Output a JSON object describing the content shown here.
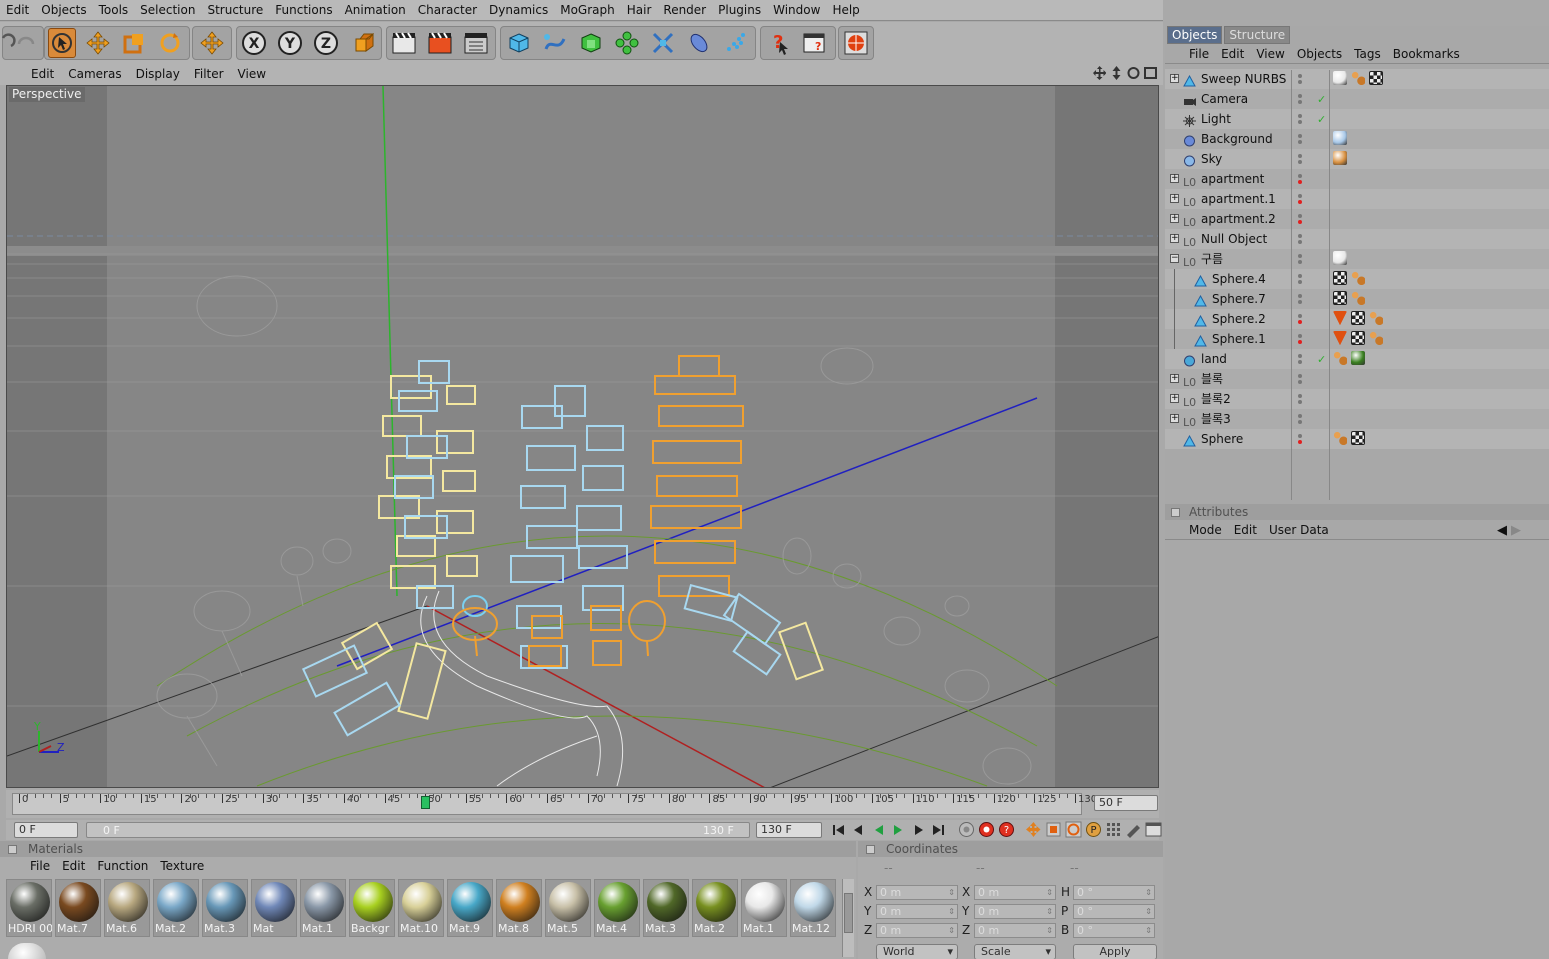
{
  "menubar": [
    "Edit",
    "Objects",
    "Tools",
    "Selection",
    "Structure",
    "Functions",
    "Animation",
    "Character",
    "Dynamics",
    "MoGraph",
    "Hair",
    "Render",
    "Plugins",
    "Window",
    "Help"
  ],
  "toolbar": {
    "axes": [
      "X",
      "Y",
      "Z"
    ],
    "icons": [
      "undo-icon",
      "redo-icon",
      "live-select-icon",
      "move-icon",
      "scale-icon",
      "rotate-icon",
      "object-axis-icon",
      "x-axis-lock-icon",
      "y-axis-lock-icon",
      "z-axis-lock-icon",
      "coordinate-system-icon",
      "render-view-icon",
      "render-picture-viewer-icon",
      "render-settings-icon",
      "cube-primitive-icon",
      "spline-icon",
      "nurbs-icon",
      "array-icon",
      "deformer-icon",
      "scene-icon",
      "particles-icon",
      "help-icon",
      "interactive-render-icon",
      "render-world-icon"
    ]
  },
  "viewport": {
    "menu": [
      "Edit",
      "Cameras",
      "Display",
      "Filter",
      "View"
    ],
    "label": "Perspective",
    "axis_labels": [
      "Y",
      "Z"
    ],
    "colors": {
      "background": "#7e7e7e",
      "floor": "#8a8a8a",
      "green_axis": "#2cb52c",
      "blue_axis": "#2020c0",
      "red_axis": "#b02020",
      "yellow_blocks": "#f4e8a0",
      "blue_blocks": "#a8d8f0",
      "orange_blocks": "#f0a030"
    }
  },
  "timeline": {
    "ticks": [
      "0",
      "5",
      "10",
      "15",
      "20",
      "25",
      "30",
      "35",
      "40",
      "45",
      "50",
      "55",
      "60",
      "65",
      "70",
      "75",
      "80",
      "85",
      "90",
      "95",
      "100",
      "105",
      "110",
      "115",
      "120",
      "125",
      "130"
    ],
    "current_frame": "50 F",
    "playhead": 50,
    "start_field": "0 F",
    "range_start": "0 F",
    "range_end": "130 F",
    "end_field": "130 F"
  },
  "materials": {
    "title": "Materials",
    "menu": [
      "File",
      "Edit",
      "Function",
      "Texture"
    ],
    "items": [
      {
        "label": "HDRI 00",
        "color": "#6a6e66"
      },
      {
        "label": "Mat.7",
        "color": "#7a4a20"
      },
      {
        "label": "Mat.6",
        "color": "#b8a880"
      },
      {
        "label": "Mat.2",
        "color": "#7aa8c8"
      },
      {
        "label": "Mat.3",
        "color": "#6898b8"
      },
      {
        "label": "Mat",
        "color": "#7088b8"
      },
      {
        "label": "Mat.1",
        "color": "#8a98a8"
      },
      {
        "label": "Backgr",
        "color": "#a8d020"
      },
      {
        "label": "Mat.10",
        "color": "#d8d098"
      },
      {
        "label": "Mat.9",
        "color": "#48a8c8"
      },
      {
        "label": "Mat.8",
        "color": "#d08020"
      },
      {
        "label": "Mat.5",
        "color": "#c8c0a8"
      },
      {
        "label": "Mat.4",
        "color": "#68a030"
      },
      {
        "label": "Mat.3",
        "color": "#506828"
      },
      {
        "label": "Mat.2",
        "color": "#789020"
      },
      {
        "label": "Mat.1",
        "color": "#e8e8e8"
      },
      {
        "label": "Mat.12",
        "color": "#c0d8e8"
      }
    ]
  },
  "coordinates": {
    "title": "Coordinates",
    "headers": [
      "--",
      "--",
      "--"
    ],
    "rows": [
      {
        "l1": "X",
        "v1": "0 m",
        "l2": "X",
        "v2": "0 m",
        "l3": "H",
        "v3": "0 °"
      },
      {
        "l1": "Y",
        "v1": "0 m",
        "l2": "Y",
        "v2": "0 m",
        "l3": "P",
        "v3": "0 °"
      },
      {
        "l1": "Z",
        "v1": "0 m",
        "l2": "Z",
        "v2": "0 m",
        "l3": "B",
        "v3": "0 °"
      }
    ],
    "mode": "World",
    "scale": "Scale",
    "apply": "Apply"
  },
  "objects": {
    "tabs": [
      "Objects",
      "Structure"
    ],
    "menu": [
      "File",
      "Edit",
      "View",
      "Objects",
      "Tags",
      "Bookmarks"
    ],
    "rows": [
      {
        "name": "Sweep NURBS",
        "indent": 0,
        "expand": true,
        "icon": "sweep-nurbs-icon",
        "red": false,
        "tags": [
          "#e8e8e8",
          "#c87828",
          "#303030"
        ]
      },
      {
        "name": "Camera",
        "indent": 0,
        "expand": false,
        "icon": "camera-icon",
        "red": false,
        "tags": []
      },
      {
        "name": "Light",
        "indent": 0,
        "expand": false,
        "icon": "light-icon",
        "red": false,
        "tags": []
      },
      {
        "name": "Background",
        "indent": 0,
        "expand": false,
        "icon": "background-icon",
        "red": false,
        "tags": [
          "#a8c8e8"
        ]
      },
      {
        "name": "Sky",
        "indent": 0,
        "expand": false,
        "icon": "sky-icon",
        "red": false,
        "tags": [
          "#d89040"
        ]
      },
      {
        "name": "apartment",
        "indent": 0,
        "expand": true,
        "icon": "null-object-icon",
        "red": true,
        "tags": []
      },
      {
        "name": "apartment.1",
        "indent": 0,
        "expand": true,
        "icon": "null-object-icon",
        "red": true,
        "tags": []
      },
      {
        "name": "apartment.2",
        "indent": 0,
        "expand": true,
        "icon": "null-object-icon",
        "red": true,
        "tags": []
      },
      {
        "name": "Null Object",
        "indent": 0,
        "expand": true,
        "icon": "null-object-icon",
        "red": false,
        "tags": []
      },
      {
        "name": "구름",
        "indent": 0,
        "expand": true,
        "icon": "null-object-icon",
        "red": false,
        "tags": [
          "#e8e8e8"
        ]
      },
      {
        "name": "Sphere.4",
        "indent": 1,
        "expand": false,
        "icon": "sphere-icon",
        "red": false,
        "tags": [
          "#303030",
          "#c87828"
        ]
      },
      {
        "name": "Sphere.7",
        "indent": 1,
        "expand": false,
        "icon": "sphere-icon",
        "red": false,
        "tags": [
          "#303030",
          "#c87828"
        ]
      },
      {
        "name": "Sphere.2",
        "indent": 1,
        "expand": false,
        "icon": "sphere-icon",
        "red": true,
        "tags": [
          "#e05010",
          "#303030",
          "#c87828"
        ]
      },
      {
        "name": "Sphere.1",
        "indent": 1,
        "expand": false,
        "icon": "sphere-icon",
        "red": true,
        "tags": [
          "#e05010",
          "#303030",
          "#c87828"
        ]
      },
      {
        "name": "land",
        "indent": 0,
        "expand": false,
        "icon": "land-icon",
        "red": false,
        "tags": [
          "#c87828",
          "#3a8020"
        ]
      },
      {
        "name": "블록",
        "indent": 0,
        "expand": true,
        "icon": "null-object-icon",
        "red": false,
        "tags": []
      },
      {
        "name": "블록2",
        "indent": 0,
        "expand": true,
        "icon": "null-object-icon",
        "red": false,
        "tags": []
      },
      {
        "name": "블록3",
        "indent": 0,
        "expand": true,
        "icon": "null-object-icon",
        "red": false,
        "tags": []
      },
      {
        "name": "Sphere",
        "indent": 0,
        "expand": false,
        "icon": "sphere-icon",
        "red": true,
        "tags": [
          "#c87828",
          "#303030"
        ]
      }
    ]
  },
  "attributes": {
    "title": "Attributes",
    "menu": [
      "Mode",
      "Edit",
      "User Data"
    ]
  }
}
